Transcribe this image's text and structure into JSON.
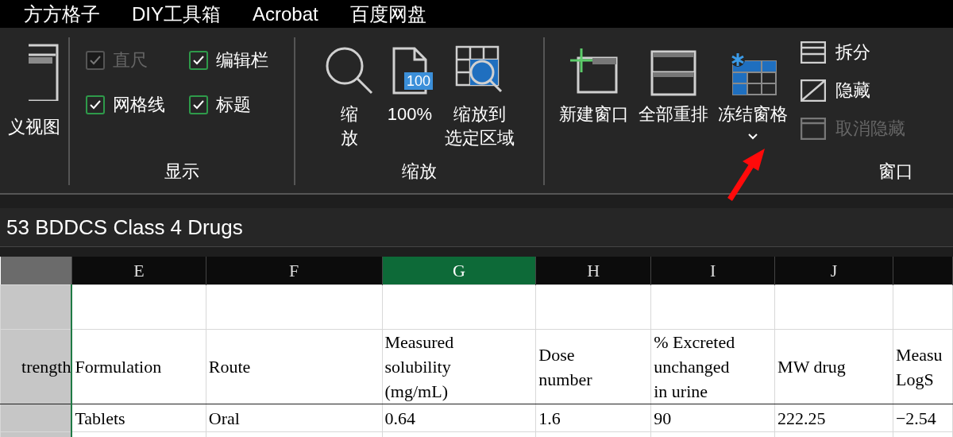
{
  "menu_bar": [
    {
      "label": "方方格子"
    },
    {
      "label": "DIY工具箱"
    },
    {
      "label": "Acrobat"
    },
    {
      "label": "百度网盘"
    }
  ],
  "ribbon": {
    "groups": [
      {
        "kind": "partial",
        "buttons": [
          {
            "kind": "view",
            "label": "义视图"
          }
        ]
      },
      {
        "kind": "checks",
        "title": "显示",
        "items": [
          {
            "label": "直尺",
            "checked": true,
            "disabled": true
          },
          {
            "label": "编辑栏",
            "checked": true,
            "disabled": false
          },
          {
            "label": "网格线",
            "checked": true,
            "disabled": false
          },
          {
            "label": "标题",
            "checked": true,
            "disabled": false
          }
        ]
      },
      {
        "kind": "large",
        "title": "缩放",
        "buttons": [
          {
            "kind": "magnifier",
            "lines": [
              "缩",
              "放"
            ]
          },
          {
            "kind": "page",
            "badge": "100",
            "lines": [
              "100%"
            ]
          },
          {
            "kind": "zoom-selection",
            "lines": [
              "缩放到",
              "选定区域"
            ]
          }
        ]
      },
      {
        "kind": "window",
        "title": "窗口",
        "buttons": [
          {
            "kind": "new-window",
            "label": "新建窗口",
            "dropdown": false
          },
          {
            "kind": "arrange",
            "label": "全部重排",
            "dropdown": false
          },
          {
            "kind": "freeze",
            "label": "冻结窗格",
            "dropdown": true
          }
        ],
        "small_buttons": [
          {
            "kind": "split",
            "label": "拆分",
            "disabled": false
          },
          {
            "kind": "hide",
            "label": "隐藏",
            "disabled": false
          },
          {
            "kind": "unhide",
            "label": "取消隐藏",
            "disabled": true
          }
        ]
      }
    ]
  },
  "sheet_title": "53 BDDCS Class 4 Drugs",
  "table": {
    "columns": [
      {
        "selected": false
      },
      {
        "label": "E",
        "selected": false
      },
      {
        "label": "F",
        "selected": false
      },
      {
        "label": "G",
        "selected": true
      },
      {
        "label": "H",
        "selected": false
      },
      {
        "label": "I",
        "selected": false
      },
      {
        "label": "J",
        "selected": false
      },
      {
        "selected": false
      }
    ],
    "rows": [
      {
        "cells": [
          "",
          "",
          "",
          "",
          "",
          "",
          "",
          ""
        ]
      },
      {
        "cells": [
          "trength",
          "Formulation",
          "Route",
          "Measured\nsolubility\n(mg/mL)",
          "Dose\nnumber",
          "% Excreted\nunchanged\nin urine",
          "MW drug",
          "Measu\nLogS"
        ]
      },
      {
        "cells": [
          "",
          "Tablets",
          "Oral",
          "0.64",
          "1.6",
          "90",
          "222.25",
          "−2.54"
        ]
      }
    ]
  }
}
